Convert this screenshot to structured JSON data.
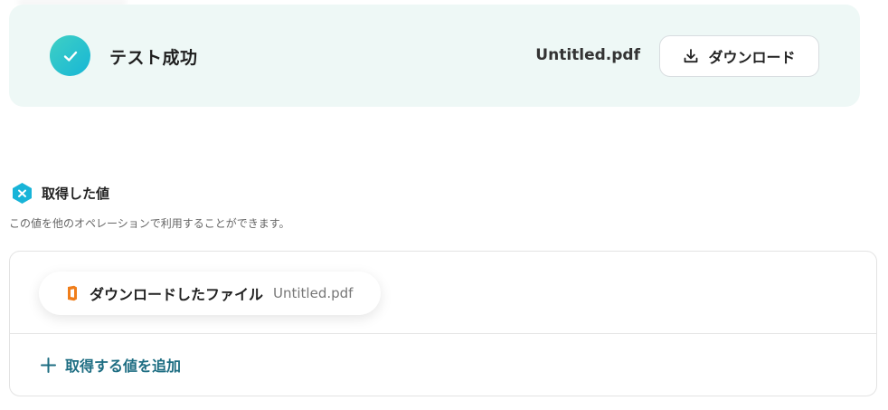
{
  "test_result": {
    "title": "テスト成功",
    "file_name": "Untitled.pdf",
    "download_label": "ダウンロード"
  },
  "acquired_values": {
    "title": "取得した値",
    "description": "この値を他のオペレーションで利用することができます。",
    "items": [
      {
        "label": "ダウンロードしたファイル",
        "value": "Untitled.pdf"
      }
    ],
    "add_label": "取得する値を追加"
  },
  "colors": {
    "success_bg": "#eef8f6",
    "check_gradient_start": "#3fd0c4",
    "check_gradient_end": "#17b6d6",
    "accent": "#1d6d82",
    "file_icon": "#f07e1b"
  }
}
